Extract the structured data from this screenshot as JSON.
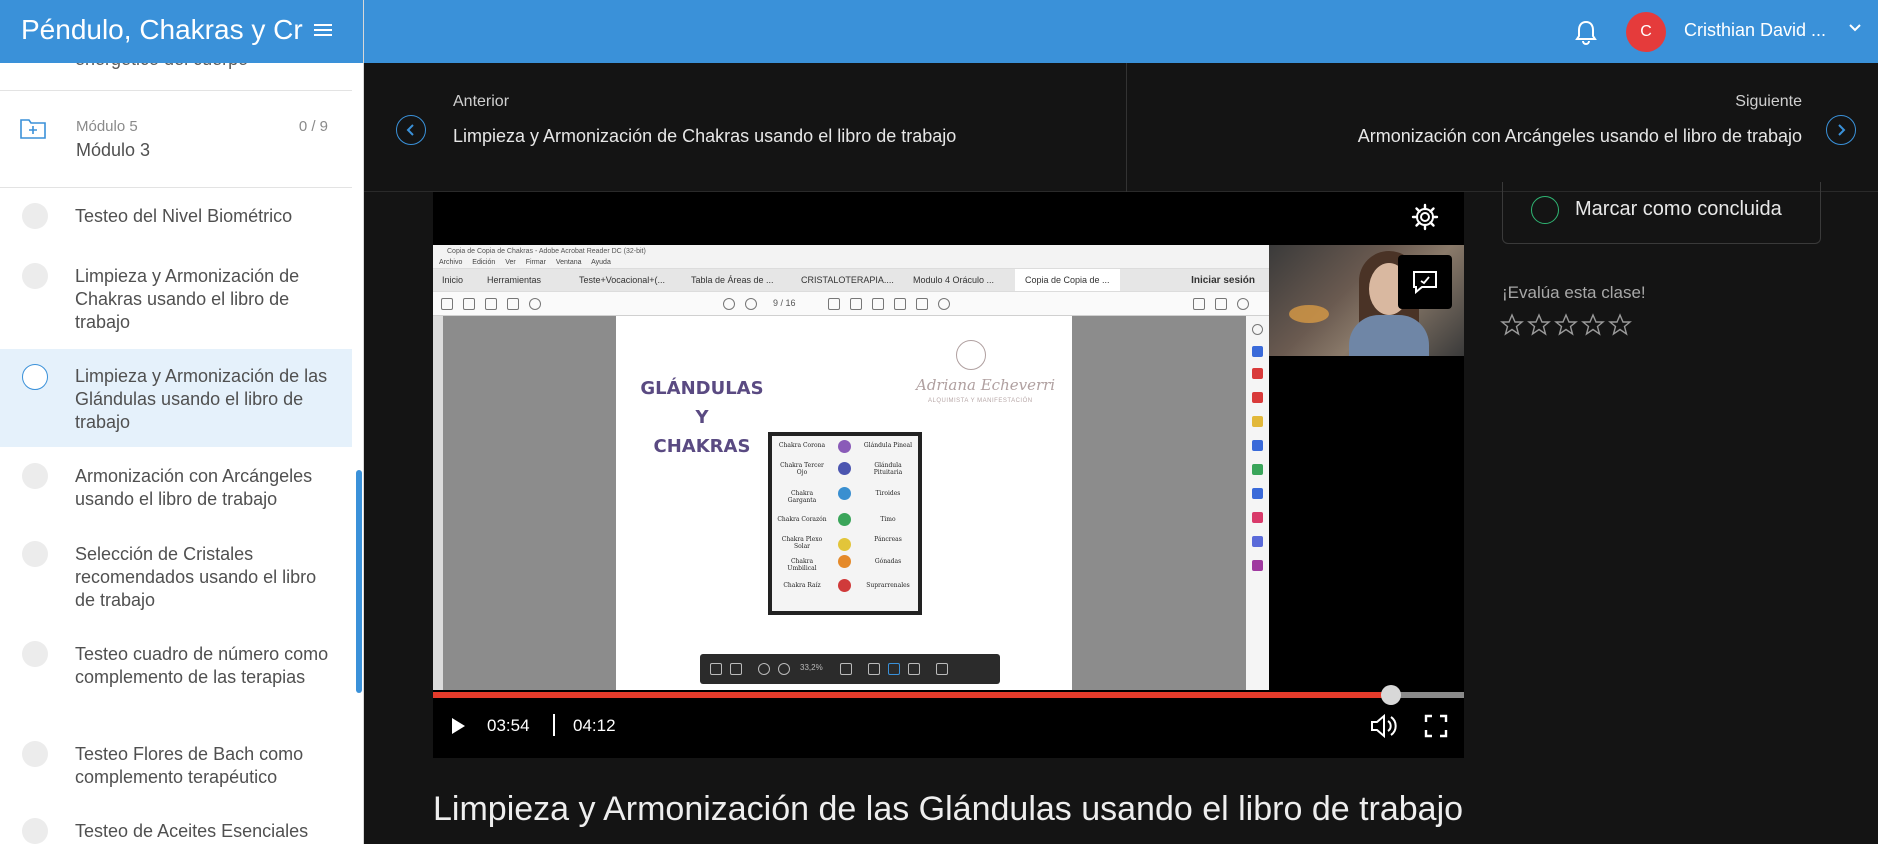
{
  "course": {
    "title": "Péndulo, Chakras y Cristales"
  },
  "sidebar": {
    "partial_item": "energético del cuerpo",
    "module": {
      "sub_label": "Módulo 5",
      "count": "0 / 9",
      "name": "Módulo 3"
    },
    "lessons": [
      {
        "text": "Testeo del Nivel Biométrico",
        "active": false
      },
      {
        "text": "Limpieza y Armonización de Chakras usando el libro de trabajo",
        "active": false
      },
      {
        "text": "Limpieza y Armonización de las Glándulas usando el libro de trabajo",
        "active": true
      },
      {
        "text": "Armonización con Arcángeles usando el libro de trabajo",
        "active": false
      },
      {
        "text": "Selección de Cristales recomendados usando el libro de trabajo",
        "active": false
      },
      {
        "text": "Testeo cuadro de número como complemento de las terapias",
        "active": false
      },
      {
        "text": "Testeo Flores de Bach como complemento terapéutico",
        "active": false
      },
      {
        "text": "Testeo de Aceites Esenciales",
        "active": false
      }
    ]
  },
  "user": {
    "avatar_letter": "C",
    "name": "Cristhian David ..."
  },
  "nav": {
    "prev_label": "Anterior",
    "prev_title": "Limpieza y Armonización de Chakras usando el libro de trabajo",
    "next_label": "Siguiente",
    "next_title": "Armonización con Arcángeles usando el libro de trabajo"
  },
  "video": {
    "current_time": "03:54",
    "duration": "04:12",
    "progress": 0.929,
    "screen": {
      "window_title": "Copia de Copia de Chakras - Adobe Acrobat Reader DC (32-bit)",
      "menu": [
        "Archivo",
        "Edición",
        "Ver",
        "Firmar",
        "Ventana",
        "Ayuda"
      ],
      "tabs": [
        "Inicio",
        "Herramientas",
        "Teste+Vocacional+(...",
        "Tabla de Áreas de ...",
        "CRISTALOTERAPIA....",
        "Modulo 4 Oráculo ...",
        "Copia de Copia de ..."
      ],
      "login": "Iniciar sesión",
      "page_indicator": "9 / 16",
      "zoom": "33,2%",
      "doc_heading_line1": "GLÁNDULAS Y",
      "doc_heading_line2": "CHAKRAS",
      "signature": "Adriana Echeverri",
      "signature_sub": "ALQUIMISTA Y MANIFESTACIÓN",
      "chakras": [
        {
          "chakra": "Chakra Corona",
          "gland": "Glándula Pineal",
          "color": "#8a5bb8"
        },
        {
          "chakra": "Chakra Tercer Ojo",
          "gland": "Glándula Pituitaria",
          "color": "#4b55b0"
        },
        {
          "chakra": "Chakra Garganta",
          "gland": "Tiroides",
          "color": "#3a8fd0"
        },
        {
          "chakra": "Chakra Corazón",
          "gland": "Timo",
          "color": "#3aa55a"
        },
        {
          "chakra": "Chakra Plexo Solar",
          "gland": "Páncreas",
          "color": "#e2c53a"
        },
        {
          "chakra": "Chakra Umbilical",
          "gland": "Gónadas",
          "color": "#e58a2a"
        },
        {
          "chakra": "Chakra Raíz",
          "gland": "Suprarrenales",
          "color": "#d03a3a"
        }
      ]
    }
  },
  "lesson": {
    "title": "Limpieza y Armonización de las Glándulas usando el libro de trabajo"
  },
  "completion": {
    "label": "Marcar como concluida"
  },
  "rating": {
    "label": "¡Evalúa esta clase!",
    "stars": 5,
    "value": 0
  },
  "colors": {
    "primary": "#3a91d9",
    "progress": "#e53b2b",
    "complete": "#2fb573",
    "avatar": "#e53b3b"
  }
}
